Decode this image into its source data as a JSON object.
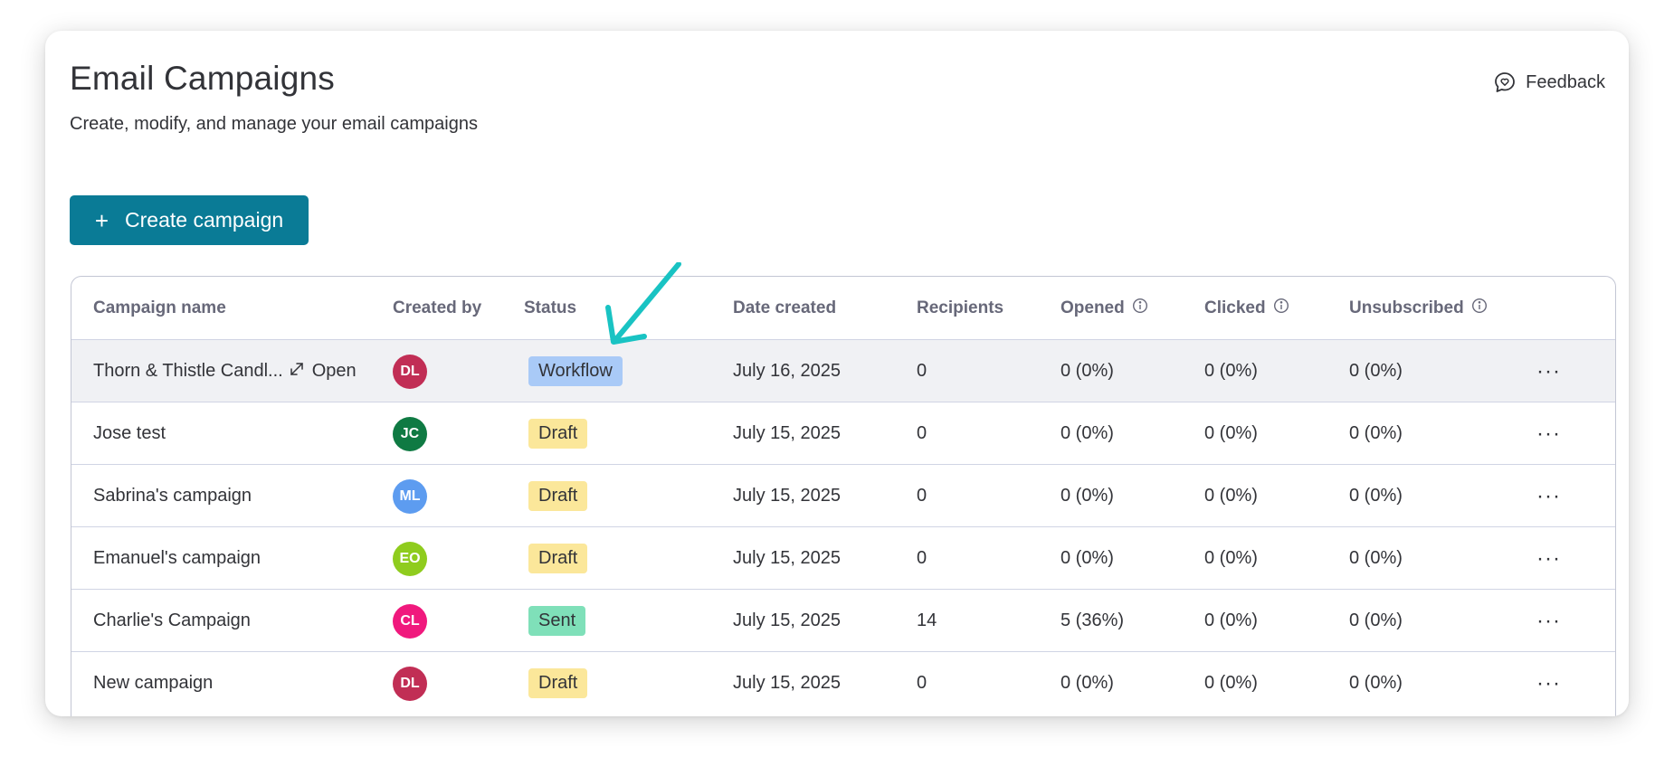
{
  "header": {
    "title": "Email Campaigns",
    "subtitle": "Create, modify, and manage your email campaigns",
    "feedback_label": "Feedback",
    "feedback_icon": "chat-bubble-heart-icon"
  },
  "toolbar": {
    "create_label": "Create campaign",
    "create_icon": "plus-icon"
  },
  "table": {
    "columns": {
      "name": "Campaign name",
      "created_by": "Created by",
      "status": "Status",
      "date": "Date created",
      "recipients": "Recipients",
      "opened": "Opened",
      "clicked": "Clicked",
      "unsubscribed": "Unsubscribed"
    },
    "info_icon": "info-circle-icon",
    "open_label": "Open",
    "more_icon": "more-horizontal-icon",
    "rows": [
      {
        "name": "Thorn & Thistle Candl...",
        "initials": "DL",
        "avatar_color": "#c12e55",
        "status": "Workflow",
        "status_color": "#a9caf7",
        "date": "July 16, 2025",
        "recipients": "0",
        "opened": "0 (0%)",
        "clicked": "0 (0%)",
        "unsubscribed": "0 (0%)",
        "more": "···"
      },
      {
        "name": "Jose test",
        "initials": "JC",
        "avatar_color": "#0f7a43",
        "status": "Draft",
        "status_color": "#fbe79a",
        "date": "July 15, 2025",
        "recipients": "0",
        "opened": "0 (0%)",
        "clicked": "0 (0%)",
        "unsubscribed": "0 (0%)",
        "more": "···"
      },
      {
        "name": "Sabrina's campaign",
        "initials": "ML",
        "avatar_color": "#5d9cf0",
        "status": "Draft",
        "status_color": "#fbe79a",
        "date": "July 15, 2025",
        "recipients": "0",
        "opened": "0 (0%)",
        "clicked": "0 (0%)",
        "unsubscribed": "0 (0%)",
        "more": "···"
      },
      {
        "name": "Emanuel's campaign",
        "initials": "EO",
        "avatar_color": "#8fcc1e",
        "status": "Draft",
        "status_color": "#fbe79a",
        "date": "July 15, 2025",
        "recipients": "0",
        "opened": "0 (0%)",
        "clicked": "0 (0%)",
        "unsubscribed": "0 (0%)",
        "more": "···"
      },
      {
        "name": "Charlie's Campaign",
        "initials": "CL",
        "avatar_color": "#f0197d",
        "status": "Sent",
        "status_color": "#7fe0b9",
        "date": "July 15, 2025",
        "recipients": "14",
        "opened": "5 (36%)",
        "clicked": "0 (0%)",
        "unsubscribed": "0 (0%)",
        "more": "···"
      },
      {
        "name": "New campaign",
        "initials": "DL",
        "avatar_color": "#c12e55",
        "status": "Draft",
        "status_color": "#fbe79a",
        "date": "July 15, 2025",
        "recipients": "0",
        "opened": "0 (0%)",
        "clicked": "0 (0%)",
        "unsubscribed": "0 (0%)",
        "more": "···"
      }
    ]
  },
  "colors": {
    "primary_button": "#0a7b96",
    "annotation_arrow": "#19c3c3",
    "row_hover": "#f0f1f4"
  },
  "annotation": {
    "icon": "arrow-pointer-icon"
  }
}
